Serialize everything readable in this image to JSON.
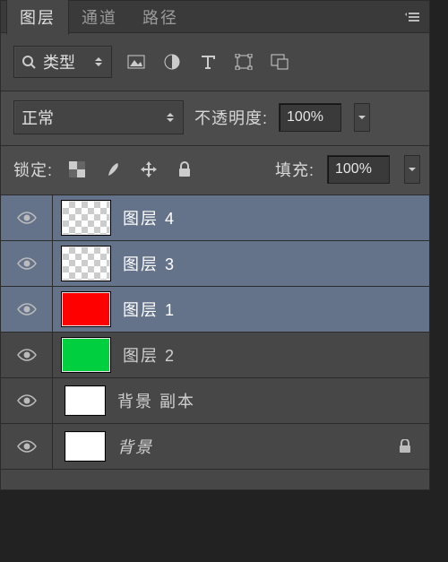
{
  "tabs": {
    "layers": "图层",
    "channels": "通道",
    "paths": "路径"
  },
  "filter": {
    "kind_label": "类型",
    "icons": [
      "image-filter",
      "adjustment-filter",
      "type-filter",
      "shape-filter",
      "smartobject-filter"
    ]
  },
  "blend": {
    "mode": "正常",
    "opacity_label": "不透明度:",
    "opacity_value": "100%"
  },
  "lock": {
    "label": "锁定:",
    "fill_label": "填充:",
    "fill_value": "100%"
  },
  "layers": [
    {
      "name": "图层 4",
      "swatch": "checker",
      "selected": true
    },
    {
      "name": "图层 3",
      "swatch": "checker",
      "selected": true
    },
    {
      "name": "图层 1",
      "swatch": "#ff0000",
      "selected": true
    },
    {
      "name": "图层 2",
      "swatch": "#00d040",
      "selected": false
    },
    {
      "name": "背景 副本",
      "swatch": "#ffffff",
      "selected": false,
      "small": true
    },
    {
      "name": "背景",
      "swatch": "#ffffff",
      "selected": false,
      "small": true,
      "italic": true,
      "locked": true
    }
  ]
}
